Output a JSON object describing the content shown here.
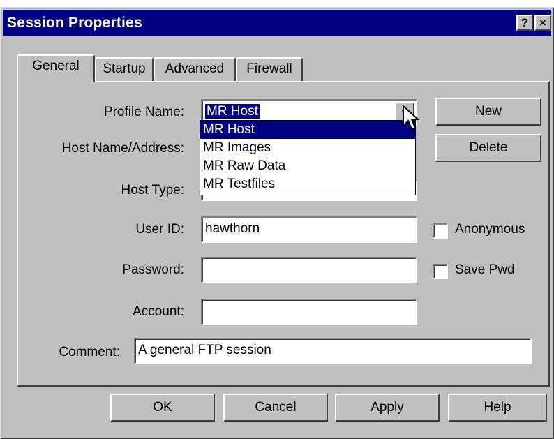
{
  "window": {
    "title": "Session Properties",
    "help_button": "?",
    "close_button": "×"
  },
  "tabs": [
    {
      "label": "General",
      "active": true
    },
    {
      "label": "Startup",
      "active": false
    },
    {
      "label": "Advanced",
      "active": false
    },
    {
      "label": "Firewall",
      "active": false
    }
  ],
  "form": {
    "profile_name": {
      "label": "Profile Name:",
      "value": "MR Host"
    },
    "host_name": {
      "label": "Host Name/Address:"
    },
    "host_type": {
      "label": "Host Type:"
    },
    "user_id": {
      "label": "User ID:",
      "value": "hawthorn"
    },
    "password": {
      "label": "Password:",
      "value": ""
    },
    "account": {
      "label": "Account:",
      "value": ""
    },
    "comment": {
      "label": "Comment:",
      "value": "A general FTP session"
    }
  },
  "dropdown": {
    "options": [
      "MR Host",
      "MR Images",
      "MR Raw Data",
      "MR Testfiles"
    ],
    "selected": "MR Host"
  },
  "side_buttons": {
    "new": "New",
    "delete": "Delete"
  },
  "checkboxes": {
    "anonymous": {
      "label": "Anonymous",
      "checked": false
    },
    "save_pwd": {
      "label": "Save Pwd",
      "checked": false
    }
  },
  "footer_buttons": {
    "ok": "OK",
    "cancel": "Cancel",
    "apply": "Apply",
    "help": "Help"
  },
  "colors": {
    "titlebar": "#000080",
    "face": "#c0c0c0",
    "selection": "#000080"
  }
}
